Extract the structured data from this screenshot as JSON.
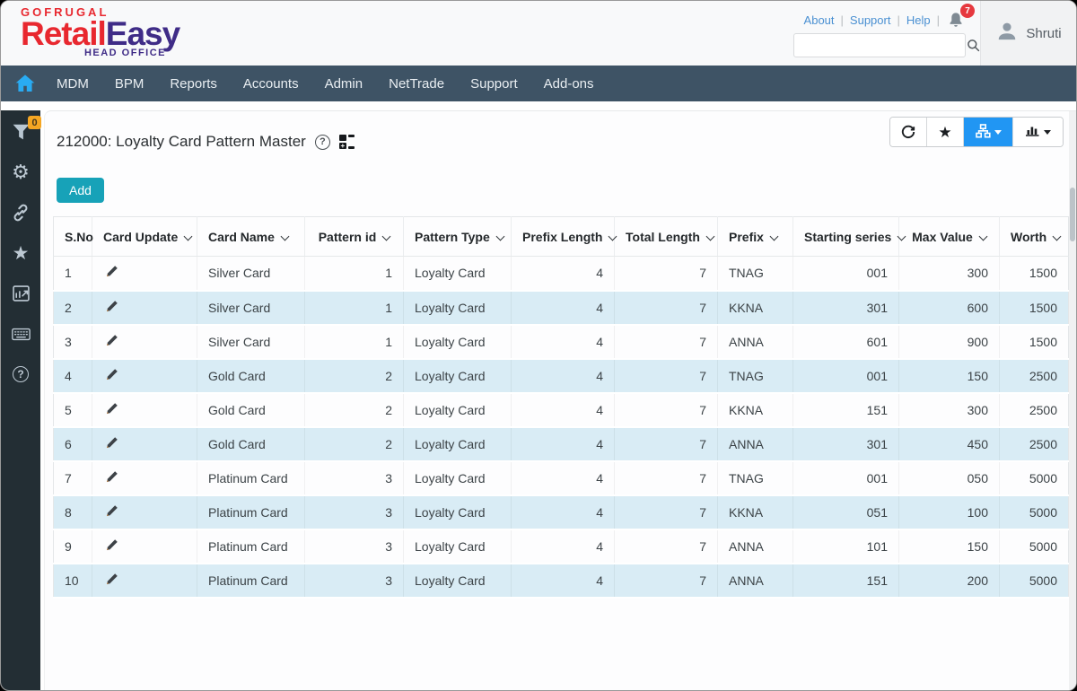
{
  "header": {
    "brand": "GOFRUGAL",
    "product": {
      "part1": "Retail",
      "part2": "Easy"
    },
    "subtitle": "HEAD OFFICE",
    "links": [
      "About",
      "Support",
      "Help"
    ],
    "notification_count": "7",
    "search": {
      "placeholder": ""
    },
    "user": {
      "name": "Shruti"
    }
  },
  "navbar": {
    "items": [
      "MDM",
      "BPM",
      "Reports",
      "Accounts",
      "Admin",
      "NetTrade",
      "Support",
      "Add-ons"
    ]
  },
  "sidebar": {
    "filter_badge": "0",
    "icons": [
      "filter-icon",
      "gear-icon",
      "link-icon",
      "star-icon",
      "report-icon",
      "keyboard-icon",
      "help-icon"
    ]
  },
  "page": {
    "title": "212000: Loyalty Card Pattern Master",
    "add_button_label": "Add",
    "toolbar_icons": [
      "refresh-icon",
      "favorite-star-icon",
      "hierarchy-view-icon",
      "chart-view-icon"
    ]
  },
  "table": {
    "columns": [
      {
        "key": "sno",
        "label": "S.No",
        "sortable": false,
        "align": "left"
      },
      {
        "key": "card_update",
        "label": "Card Update",
        "sortable": true,
        "align": "left",
        "type": "edit"
      },
      {
        "key": "card_name",
        "label": "Card Name",
        "sortable": true,
        "align": "left"
      },
      {
        "key": "pattern_id",
        "label": "Pattern id",
        "sortable": true,
        "align": "right"
      },
      {
        "key": "pattern_type",
        "label": "Pattern Type",
        "sortable": true,
        "align": "left"
      },
      {
        "key": "prefix_length",
        "label": "Prefix Length",
        "sortable": true,
        "align": "right"
      },
      {
        "key": "total_length",
        "label": "Total Length",
        "sortable": true,
        "align": "right"
      },
      {
        "key": "prefix",
        "label": "Prefix",
        "sortable": true,
        "align": "left"
      },
      {
        "key": "starting_series",
        "label": "Starting series",
        "sortable": true,
        "align": "right"
      },
      {
        "key": "max_value",
        "label": "Max Value",
        "sortable": true,
        "align": "right"
      },
      {
        "key": "worth",
        "label": "Worth",
        "sortable": true,
        "align": "right"
      }
    ],
    "rows": [
      {
        "sno": "1",
        "card_name": "Silver Card",
        "pattern_id": "1",
        "pattern_type": "Loyalty Card",
        "prefix_length": "4",
        "total_length": "7",
        "prefix": "TNAG",
        "starting_series": "001",
        "max_value": "300",
        "worth": "1500"
      },
      {
        "sno": "2",
        "card_name": "Silver Card",
        "pattern_id": "1",
        "pattern_type": "Loyalty Card",
        "prefix_length": "4",
        "total_length": "7",
        "prefix": "KKNA",
        "starting_series": "301",
        "max_value": "600",
        "worth": "1500"
      },
      {
        "sno": "3",
        "card_name": "Silver Card",
        "pattern_id": "1",
        "pattern_type": "Loyalty Card",
        "prefix_length": "4",
        "total_length": "7",
        "prefix": "ANNA",
        "starting_series": "601",
        "max_value": "900",
        "worth": "1500"
      },
      {
        "sno": "4",
        "card_name": "Gold Card",
        "pattern_id": "2",
        "pattern_type": "Loyalty Card",
        "prefix_length": "4",
        "total_length": "7",
        "prefix": "TNAG",
        "starting_series": "001",
        "max_value": "150",
        "worth": "2500"
      },
      {
        "sno": "5",
        "card_name": "Gold Card",
        "pattern_id": "2",
        "pattern_type": "Loyalty Card",
        "prefix_length": "4",
        "total_length": "7",
        "prefix": "KKNA",
        "starting_series": "151",
        "max_value": "300",
        "worth": "2500"
      },
      {
        "sno": "6",
        "card_name": "Gold Card",
        "pattern_id": "2",
        "pattern_type": "Loyalty Card",
        "prefix_length": "4",
        "total_length": "7",
        "prefix": "ANNA",
        "starting_series": "301",
        "max_value": "450",
        "worth": "2500"
      },
      {
        "sno": "7",
        "card_name": "Platinum Card",
        "pattern_id": "3",
        "pattern_type": "Loyalty Card",
        "prefix_length": "4",
        "total_length": "7",
        "prefix": "TNAG",
        "starting_series": "001",
        "max_value": "050",
        "worth": "5000"
      },
      {
        "sno": "8",
        "card_name": "Platinum Card",
        "pattern_id": "3",
        "pattern_type": "Loyalty Card",
        "prefix_length": "4",
        "total_length": "7",
        "prefix": "KKNA",
        "starting_series": "051",
        "max_value": "100",
        "worth": "5000"
      },
      {
        "sno": "9",
        "card_name": "Platinum Card",
        "pattern_id": "3",
        "pattern_type": "Loyalty Card",
        "prefix_length": "4",
        "total_length": "7",
        "prefix": "ANNA",
        "starting_series": "101",
        "max_value": "150",
        "worth": "5000"
      },
      {
        "sno": "10",
        "card_name": "Platinum Card",
        "pattern_id": "3",
        "pattern_type": "Loyalty Card",
        "prefix_length": "4",
        "total_length": "7",
        "prefix": "ANNA",
        "starting_series": "151",
        "max_value": "200",
        "worth": "5000"
      }
    ]
  },
  "colors": {
    "accent_teal": "#17a2b8",
    "active_blue": "#2196f3",
    "navbar": "#3e5365",
    "sidebar": "#232e34",
    "row_alt": "#d9ecf5",
    "brand_red": "#e8282f",
    "brand_purple": "#3f2c87",
    "badge_red": "#e6393f",
    "badge_orange": "#f5a623",
    "link_blue": "#4a90d2"
  }
}
